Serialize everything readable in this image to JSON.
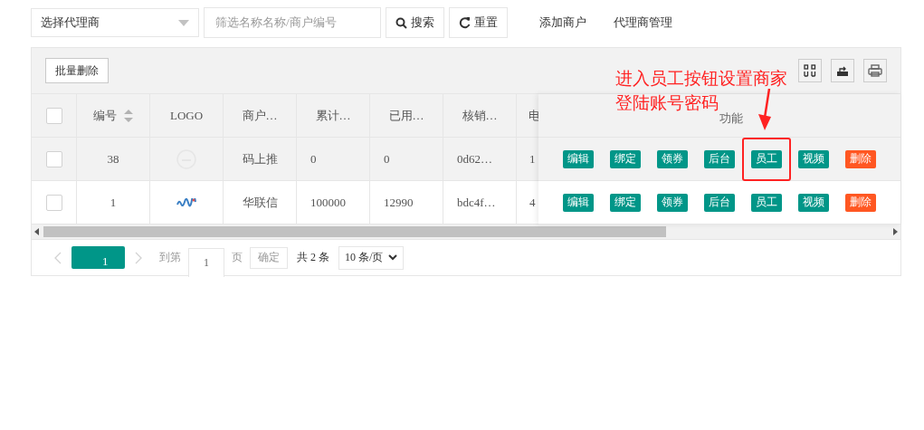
{
  "filters": {
    "agent_select": {
      "value": "选择代理商"
    },
    "search": {
      "placeholder": "筛选名称名称/商户编号"
    },
    "buttons": [
      {
        "label": "搜索",
        "kind": "search"
      },
      {
        "label": "重置",
        "kind": "reset"
      }
    ]
  },
  "nav_links": [
    "添加商户",
    "代理商管理"
  ],
  "toolbar": {
    "button": "批量删除"
  },
  "table": {
    "all_checked": false,
    "columns": [
      {
        "label": "编号",
        "sortable": true
      },
      {
        "label": "LOGO",
        "sortable": false
      },
      {
        "label": "商户…",
        "sortable": false
      },
      {
        "label": "累计…",
        "sortable": false
      },
      {
        "label": "已用…",
        "sortable": false
      },
      {
        "label": "核销…",
        "sortable": false
      },
      {
        "label": "电",
        "sortable": false
      }
    ],
    "action_column": "功能",
    "rows": [
      {
        "checked": false,
        "highlighted": true,
        "id": "38",
        "logo": {
          "kind": "placeholder"
        },
        "name": "码上推",
        "total": "0",
        "used": "0",
        "code": "0d62…",
        "phone": "1",
        "actions": [
          {
            "label": "编辑",
            "kind": "normal",
            "boxed": false
          },
          {
            "label": "绑定",
            "kind": "normal",
            "boxed": false
          },
          {
            "label": "领券",
            "kind": "normal",
            "boxed": false
          },
          {
            "label": "后台",
            "kind": "normal",
            "boxed": false
          },
          {
            "label": "员工",
            "kind": "normal",
            "boxed": true
          },
          {
            "label": "视频",
            "kind": "normal",
            "boxed": false
          },
          {
            "label": "删除",
            "kind": "danger",
            "boxed": false
          }
        ]
      },
      {
        "checked": false,
        "highlighted": false,
        "id": "1",
        "name": "华联信",
        "total": "100000",
        "used": "12990",
        "code": "bdc4f…",
        "phone": "4",
        "actions": [
          {
            "label": "编辑",
            "kind": "normal",
            "boxed": false
          },
          {
            "label": "绑定",
            "kind": "normal",
            "boxed": false
          },
          {
            "label": "领券",
            "kind": "normal",
            "boxed": false
          },
          {
            "label": "后台",
            "kind": "normal",
            "boxed": false
          },
          {
            "label": "员工",
            "kind": "normal",
            "boxed": false
          },
          {
            "label": "视频",
            "kind": "normal",
            "boxed": false
          },
          {
            "label": "删除",
            "kind": "danger",
            "boxed": false
          }
        ]
      }
    ]
  },
  "pager": {
    "pages": [
      {
        "label": "1",
        "selected": true
      }
    ],
    "goto_label": "到第",
    "goto_value": "1",
    "page_unit": "页",
    "confirm": "确定",
    "total": "共 2 条",
    "page_size": "10 条/页"
  },
  "annotation": {
    "lines": [
      "进入员工按钮设置商家",
      "登陆账号密码"
    ]
  }
}
